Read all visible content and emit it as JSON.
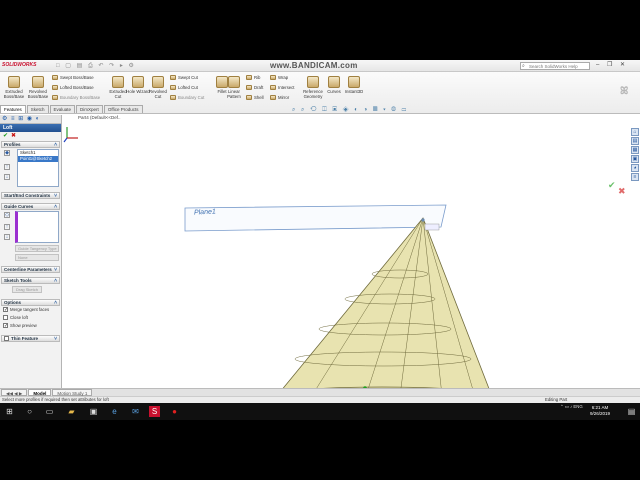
{
  "app": {
    "logo": "SOLIDWORKS",
    "watermark": "www.BANDICAM.com",
    "search_placeholder": "Search SolidWorks Help",
    "window_controls": "– ❐ ✕",
    "quickbar": "□ ▢ ▤ ⎙ ↶ ↷ ▸ ⚙"
  },
  "toolbar": {
    "extruded_boss": "Extruded Boss/Base",
    "revolved_boss": "Revolved Boss/Base",
    "swept_boss": "Swept Boss/Base",
    "lofted_boss": "Lofted Boss/Base",
    "boundary_boss": "Boundary Boss/Base",
    "extruded_cut": "Extruded Cut",
    "hole_wizard": "Hole Wizard",
    "revolved_cut": "Revolved Cut",
    "swept_cut": "Swept Cut",
    "lofted_cut": "Lofted Cut",
    "boundary_cut": "Boundary Cut",
    "fillet": "Fillet",
    "linear_pattern": "Linear Pattern",
    "rib": "Rib",
    "draft": "Draft",
    "shell": "Shell",
    "wrap": "Wrap",
    "intersect": "Intersect",
    "mirror": "Mirror",
    "reference_geometry": "Reference Geometry",
    "curves": "Curves",
    "instant3d": "Instant3D"
  },
  "command_tabs": [
    "Features",
    "Sketch",
    "Evaluate",
    "DimXpert",
    "Office Products"
  ],
  "tree_title": "Part4 (Default<<Def..",
  "panel": {
    "tab_icons": "⚙ ≡ ⊞ ◉ ◐",
    "title": "Loft",
    "ok_symbol": "✔",
    "cancel_symbol": "✖",
    "profiles_header": "Profiles",
    "profile_items": [
      "Sketch1",
      "Point1@Sketch2"
    ],
    "start_end_header": "Start/End Constraints",
    "guide_curves_header": "Guide Curves",
    "guide_tangency_placeholder": "Guide Tangency Type",
    "guide_none": "None",
    "centerline_header": "Centerline Parameters",
    "sketch_tools_header": "Sketch Tools",
    "drag_sketch": "Drag Sketch",
    "options_header": "Options",
    "options": [
      {
        "label": "Merge tangent faces",
        "checked": true
      },
      {
        "label": "Close loft",
        "checked": false
      },
      {
        "label": "Show preview",
        "checked": true
      }
    ],
    "thin_feature": "Thin Feature"
  },
  "graphics": {
    "plane_label": "Plane1",
    "ok_symbol": "✔",
    "cancel_symbol": "✖"
  },
  "bottom_tabs": [
    "Model",
    "Motion Study 1"
  ],
  "status": {
    "message": "Select more profiles if required then set attributes for loft",
    "mode": "Editing Part"
  },
  "taskbar": {
    "time": "6:21 AM",
    "date": "9/26/2019",
    "lang": "ENG"
  },
  "colors": {
    "accent": "#23508f",
    "loft_fill": "#e8e3b0",
    "loft_edge": "#6f6a3c",
    "plane": "#3d6fb0"
  }
}
